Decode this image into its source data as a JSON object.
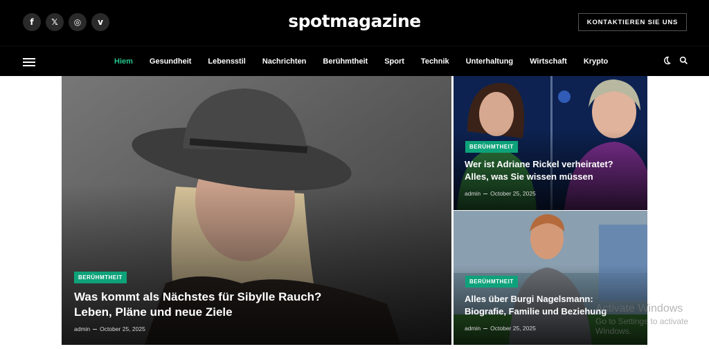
{
  "header": {
    "logo": "spotmagazine",
    "contact_label": "KONTAKTIEREN SIE UNS",
    "social": [
      {
        "icon": "facebook-icon",
        "glyph": "f"
      },
      {
        "icon": "x-icon",
        "glyph": "𝕏"
      },
      {
        "icon": "instagram-icon",
        "glyph": "◎"
      },
      {
        "icon": "vimeo-icon",
        "glyph": "v"
      }
    ]
  },
  "nav": {
    "items": [
      "Hiem",
      "Gesundheit",
      "Lebensstil",
      "Nachrichten",
      "Berühmtheit",
      "Sport",
      "Technik",
      "Unterhaltung",
      "Wirtschaft",
      "Krypto"
    ],
    "active_index": 0,
    "right_icons": [
      "dark-mode-icon",
      "search-icon"
    ]
  },
  "articles": {
    "featured": {
      "category": "BERÜHMTHEIT",
      "title_line1": "Was kommt als Nächstes für Sibylle Rauch?",
      "title_line2": "Leben, Pläne und neue Ziele",
      "author": "admin",
      "date": "October 25, 2025"
    },
    "side1": {
      "category": "BERÜHMTHEIT",
      "title_line1": "Wer ist Adriane Rickel verheiratet?",
      "title_line2": "Alles, was Sie wissen müssen",
      "author": "admin",
      "date": "October 25, 2025"
    },
    "side2": {
      "category": "BERÜHMTHEIT",
      "title_line1": "Alles über Burgi Nagelsmann:",
      "title_line2": "Biografie, Familie und Beziehung",
      "author": "admin",
      "date": "October 25, 2025"
    }
  },
  "watermark": {
    "line1": "Activate Windows",
    "line2": "Go to Settings to activate Windows."
  },
  "colors": {
    "accent": "#26c58d",
    "badge": "#0ea27a",
    "header_bg": "#000000"
  }
}
